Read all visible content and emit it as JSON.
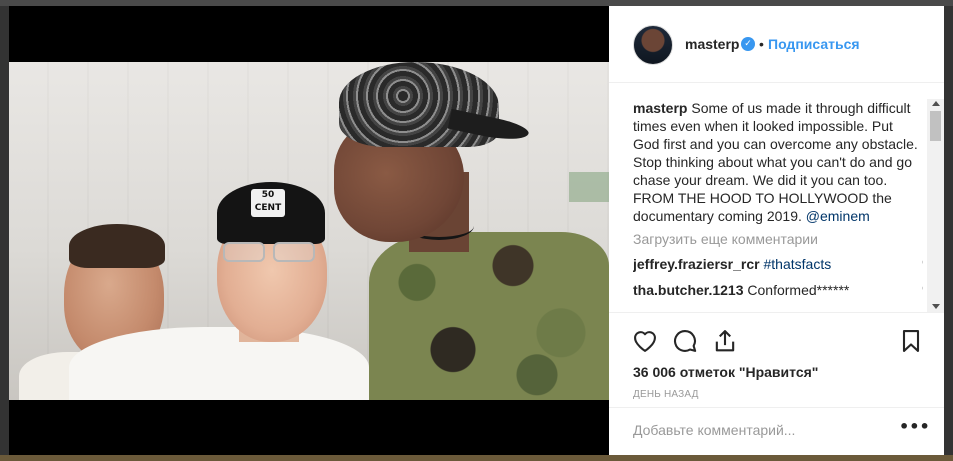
{
  "post": {
    "username": "masterp",
    "verified_icon": "verified-badge-icon",
    "follow_label": "Подписаться",
    "separator": "•",
    "caption_user": "masterp",
    "caption_text": " Some of us made it through difficult times even when it looked impossible. Put God first and you can overcome any obstacle. Stop thinking about what you can't do and go chase your dream. We did it you can too. FROM THE HOOD TO HOLLYWOOD the documentary coming 2019. ",
    "caption_mention": "@eminem",
    "load_more": "Загрузить еще комментарии",
    "comments": [
      {
        "user": "jeffrey.fraziersr_rcr",
        "text": "#thatsfacts",
        "is_hashtag": true
      },
      {
        "user": "tha.butcher.1213",
        "text": "Conformed******",
        "is_hashtag": false
      }
    ],
    "likes": "36 006 отметок \"Нравится\"",
    "time": "ДЕНЬ НАЗАД",
    "add_comment_placeholder": "Добавьте комментарий...",
    "more_label": "•••"
  },
  "photo": {
    "cap_logo": "50 CENT"
  },
  "colors": {
    "link": "#3897f0",
    "text": "#262626",
    "muted": "#999999",
    "mention": "#003569"
  },
  "icons": [
    "heart-icon",
    "comment-icon",
    "share-icon",
    "bookmark-icon",
    "small-heart-icon"
  ]
}
